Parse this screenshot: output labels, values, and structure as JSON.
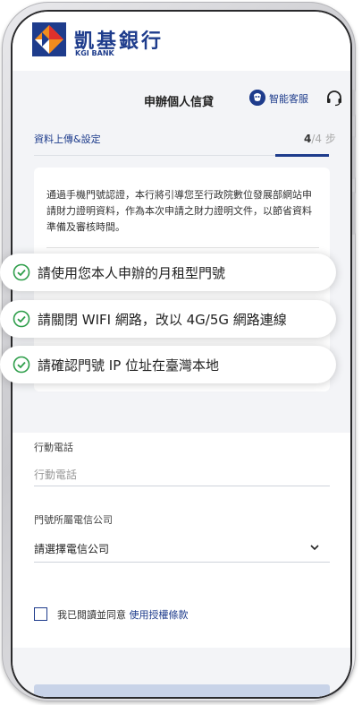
{
  "brand": {
    "name_cn": "凱基銀行",
    "name_en": "KGI BANK",
    "colors": {
      "primary": "#1e3c8c",
      "accent_orange": "#f08c1e",
      "accent_red": "#e0302c",
      "check_green": "#2e9e4a"
    }
  },
  "header": {
    "title": "申辦個人信貸",
    "service_label": "智能客服",
    "service_icon": "chat-bot-icon",
    "support_icon": "headset-icon"
  },
  "step": {
    "label": "資料上傳&設定",
    "current": "4",
    "total": "/4 步"
  },
  "notice": {
    "text": "通過手機門號認證，本行將引導您至行政院數位發展部網站申請財力證明資料，作為本次申請之財力證明文件，以節省資料準備及審核時間。"
  },
  "requirements": [
    {
      "text": "請使用您本人申辦的月租型門號"
    },
    {
      "text": "請關閉 WIFI 網路，改以 4G/5G 網路連線"
    },
    {
      "text": "請確認門號 IP 位址在臺灣本地"
    }
  ],
  "form": {
    "phone_label": "行動電話",
    "phone_placeholder": "行動電話",
    "phone_value": "",
    "carrier_label": "門號所屬電信公司",
    "carrier_value": "請選擇電信公司",
    "agree_text": "我已閱讀並同意 ",
    "agree_link": "使用授權條款",
    "agree_checked": false
  }
}
